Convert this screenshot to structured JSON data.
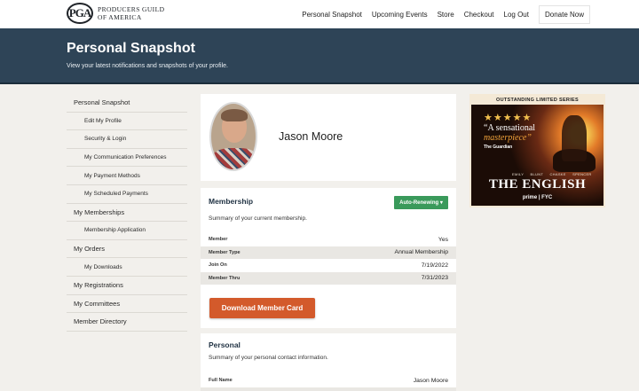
{
  "brand": {
    "logo_mark": "PGA",
    "logo_text": "PRODUCERS GUILD\nOF AMERICA"
  },
  "nav": {
    "items": [
      "Personal Snapshot",
      "Upcoming Events",
      "Store",
      "Checkout",
      "Log Out"
    ],
    "donate": "Donate Now"
  },
  "header": {
    "title": "Personal Snapshot",
    "subtitle": "View your latest notifications and snapshots of your profile."
  },
  "sidebar": {
    "items": [
      {
        "label": "Personal Snapshot",
        "sub": false
      },
      {
        "label": "Edit My Profile",
        "sub": true
      },
      {
        "label": "Security & Login",
        "sub": true
      },
      {
        "label": "My Communication Preferences",
        "sub": true
      },
      {
        "label": "My Payment Methods",
        "sub": true
      },
      {
        "label": "My Scheduled Payments",
        "sub": true
      },
      {
        "label": "My Memberships",
        "sub": false
      },
      {
        "label": "Membership Application",
        "sub": true
      },
      {
        "label": "My Orders",
        "sub": false
      },
      {
        "label": "My Downloads",
        "sub": true
      },
      {
        "label": "My Registrations",
        "sub": false
      },
      {
        "label": "My Committees",
        "sub": false
      },
      {
        "label": "Member Directory",
        "sub": false
      }
    ]
  },
  "profile": {
    "name": "Jason Moore"
  },
  "membership": {
    "title": "Membership",
    "status_button": "Auto-Renewing ▾",
    "description": "Summary of your current membership.",
    "rows": [
      {
        "key": "Member",
        "value": "Yes"
      },
      {
        "key": "Member Type",
        "value": "Annual Membership"
      },
      {
        "key": "Join On",
        "value": "7/19/2022"
      },
      {
        "key": "Member Thru",
        "value": "7/31/2023"
      }
    ],
    "download_button": "Download Member Card"
  },
  "personal": {
    "title": "Personal",
    "description": "Summary of your personal contact information.",
    "rows": [
      {
        "key": "Full Name",
        "value": "Jason Moore"
      },
      {
        "key": "",
        "value": ""
      }
    ]
  },
  "ad": {
    "banner": "OUTSTANDING LIMITED SERIES",
    "stars": "★★★★★",
    "quote_line1": "“A sensational",
    "quote_line2": "masterpiece”",
    "quote_source": "The Guardian",
    "cast": "EMILY BLUNT  CHASKE SPENCER",
    "title": "THE ENGLISH",
    "footer": "prime | FYC"
  },
  "colors": {
    "header_bg": "#2e4457",
    "accent_green": "#3a9a5b",
    "accent_orange": "#d35a2b",
    "page_bg": "#f2f0ec"
  }
}
